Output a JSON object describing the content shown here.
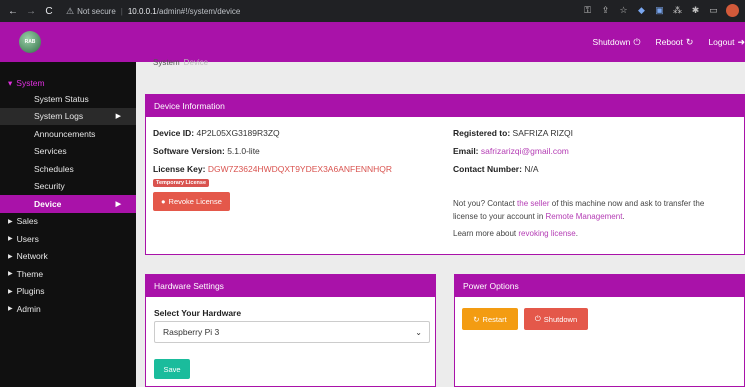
{
  "browser": {
    "back_icon": "←",
    "forward_icon": "→",
    "reload_icon": "C",
    "warning_icon": "⚠",
    "security_text": "Not secure",
    "separator": "|",
    "url_host": "10.0.0.1",
    "url_path": "/admin#!/system/device"
  },
  "header": {
    "logo_text": "RAB",
    "shutdown_label": "Shutdown",
    "reboot_label": "Reboot",
    "logout_label": "Logout",
    "power_icon": "⏻",
    "reboot_icon": "↻",
    "logout_icon": "➜"
  },
  "sidebar": {
    "group_label": "System",
    "group_caret": "▾",
    "items": [
      {
        "label": "System Status"
      },
      {
        "label": "System Logs"
      },
      {
        "label": "Announcements"
      },
      {
        "label": "Services"
      },
      {
        "label": "Schedules"
      },
      {
        "label": "Security"
      },
      {
        "label": "Device"
      }
    ],
    "sections": [
      {
        "label": "Sales"
      },
      {
        "label": "Users"
      },
      {
        "label": "Network"
      },
      {
        "label": "Theme"
      },
      {
        "label": "Plugins"
      },
      {
        "label": "Admin"
      }
    ],
    "caret_icon": "▶",
    "section_icon": "▶"
  },
  "breadcrumb": {
    "parent": "System",
    "current": "Device"
  },
  "device": {
    "title": "Device Information",
    "device_id_label": "Device ID:",
    "device_id": "4P2L05XG3189R3ZQ",
    "software_label": "Software Version:",
    "software_version": "5.1.0-lite",
    "license_label": "License Key:",
    "license_key": "DGW7Z3624HWDQXT9YDEX3A6ANFENNHQR",
    "temp_badge": "Temporary License",
    "revoke_label": "Revoke License",
    "revoke_icon": "●",
    "registered_label": "Registered to:",
    "registered_to": "SAFRIZA RIZQI",
    "email_label": "Email:",
    "email": "safrizarizqi@gmail.com",
    "contact_label": "Contact Number:",
    "contact": "N/A",
    "note_line1_pre": "Not you? Contact ",
    "note_link1": "the seller",
    "note_line1_post": " of this machine now and ask to transfer the",
    "note_line2_pre": "license to your account in ",
    "note_link2": "Remote Management",
    "note_line2_post": ".",
    "note_line3_pre": "Learn more about ",
    "note_link3": "revoking license",
    "note_line3_post": "."
  },
  "hardware": {
    "title": "Hardware Settings",
    "select_label": "Select Your Hardware",
    "selected": "Raspberry Pi 3",
    "chevron": "⌄",
    "save_label": "Save"
  },
  "power": {
    "title": "Power Options",
    "restart_label": "Restart",
    "shutdown_label": "Shutdown",
    "restart_icon": "↻",
    "shutdown_icon": "⏻"
  },
  "colors": {
    "accent": "#a912a9",
    "danger": "#e4584a",
    "warning": "#f39c12",
    "success": "#1abc9c"
  }
}
